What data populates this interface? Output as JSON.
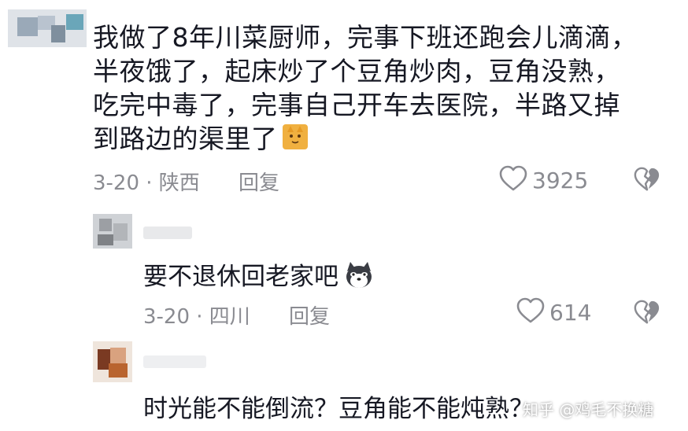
{
  "comments": [
    {
      "text_lines": [
        "我做了8年川菜厨师，完事下班还跑会儿滴滴，",
        "半夜饿了，起床炒了个豆角炒肉，豆角没熟，",
        "吃完中毒了，完事自己开车去医院，半路又掉",
        "到路边的渠里了"
      ],
      "emoji": "cat-emoji",
      "date_location": "3-20 · 陕西",
      "reply_label": "回复",
      "likes": "3925"
    },
    {
      "text": "要不退休回老家吧",
      "emoji": "husky-emoji",
      "date_location": "3-20 · 四川",
      "reply_label": "回复",
      "likes": "614"
    },
    {
      "text": "时光能不能倒流？豆角能不能炖熟？",
      "emoji": ""
    }
  ],
  "watermark": "知乎 @鸡毛不换糖",
  "icons": {
    "like": "heart-outline-icon",
    "dislike": "broken-heart-icon"
  },
  "colors": {
    "text": "#161823",
    "meta": "#8a8b91"
  }
}
